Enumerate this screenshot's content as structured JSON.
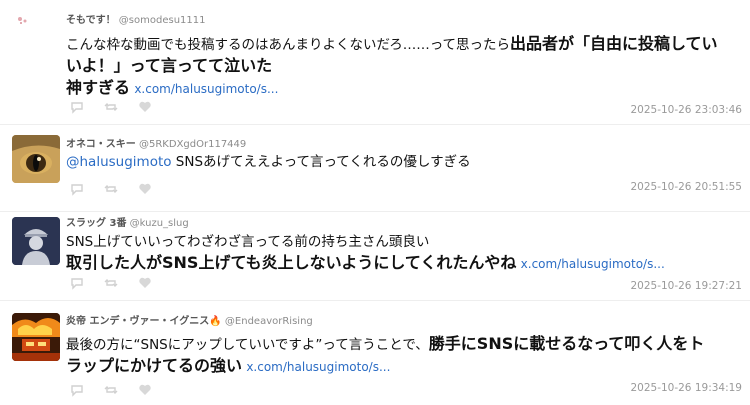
{
  "posts": [
    {
      "display_name": "そもです！",
      "handle": "@somodesu1111",
      "text_plain": "こんな枠な動画でも投稿するのはあんまりよくないだろ……って思ったら",
      "text_bold_1": "出品者が「自由に投稿してい",
      "text_bold_2": "いよ！」って言ってて泣いた",
      "text_bold_3": "神すぎる",
      "link": "x.com/halusugimoto/s...",
      "timestamp": "2025-10-26 23:03:46"
    },
    {
      "display_name": "オネコ・スキー",
      "handle": "@5RKDXgdOr117449",
      "mention": "@halusugimoto",
      "text_plain": " SNSあげてええよって言ってくれるの優しすぎる",
      "timestamp": "2025-10-26 20:51:55"
    },
    {
      "display_name": "スラッグ 3番",
      "handle": "@kuzu_slug",
      "text_plain": "SNS上げていいってわざわざ言ってる前の持ち主さん頭良い",
      "text_bold_1": "取引した人がSNS上げても炎上しないようにしてくれたんやね",
      "link": "x.com/halusugimoto/s...",
      "timestamp": "2025-10-26 19:27:21"
    },
    {
      "display_name": "炎帝 エンデ・ヴァー・イグニス🔥",
      "handle": "@EndeavorRising",
      "text_plain": "最後の方に“SNSにアップしていいですよ”って言うことで、",
      "text_bold_1": "勝手にSNSに載せるなって叩く人をト",
      "text_bold_2": "ラップにかけてるの強い",
      "link": "x.com/halusugimoto/s...",
      "timestamp": "2025-10-26 19:34:19"
    }
  ],
  "icons": [
    "reply-icon",
    "retweet-icon",
    "like-icon"
  ],
  "colors": {
    "link": "#2b6cc4",
    "meta": "#9a9a9a",
    "separator": "#eeeeee"
  }
}
